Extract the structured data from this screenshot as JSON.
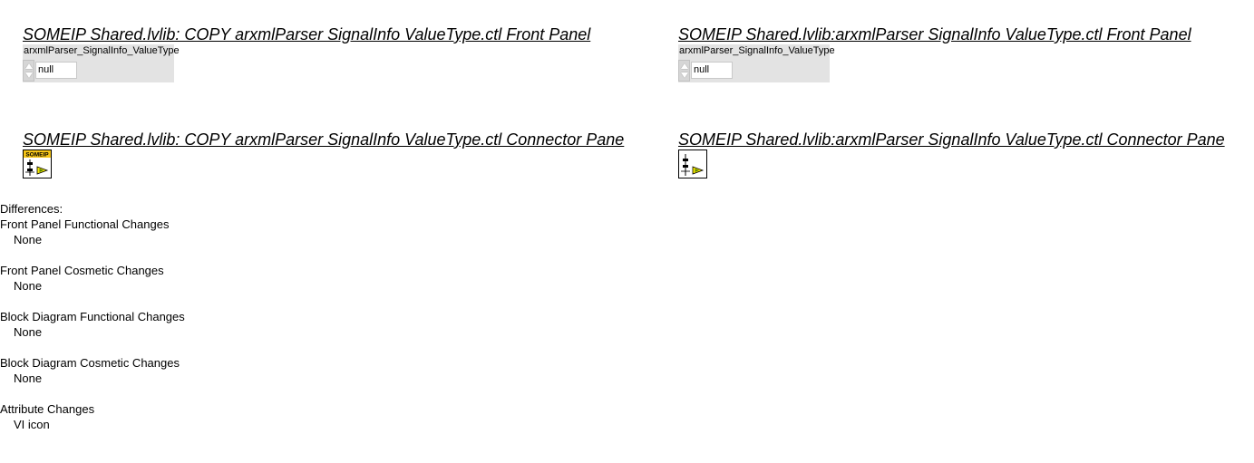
{
  "left": {
    "front_panel_title": "SOMEIP Shared.lvlib:  COPY  arxmlParser  SignalInfo  ValueType.ctl Front Panel",
    "control_label": "arxmlParser_SignalInfo_ValueType",
    "control_value": "null",
    "connector_pane_title": "SOMEIP Shared.lvlib:  COPY  arxmlParser  SignalInfo  ValueType.ctl Connector Pane",
    "icon_banner": "SOMEIP"
  },
  "right": {
    "front_panel_title": "SOMEIP Shared.lvlib:arxmlParser  SignalInfo  ValueType.ctl Front Panel",
    "control_label": "arxmlParser_SignalInfo_ValueType",
    "control_value": "null",
    "connector_pane_title": "SOMEIP Shared.lvlib:arxmlParser  SignalInfo  ValueType.ctl Connector Pane"
  },
  "differences": {
    "heading": "Differences:",
    "sections": [
      {
        "title": "Front Panel Functional Changes",
        "value": "None"
      },
      {
        "title": "Front Panel Cosmetic Changes",
        "value": "None"
      },
      {
        "title": "Block Diagram Functional Changes",
        "value": "None"
      },
      {
        "title": "Block Diagram Cosmetic Changes",
        "value": "None"
      },
      {
        "title": "Attribute Changes",
        "value": "VI icon"
      }
    ]
  },
  "colors": {
    "panel_background": "#e3e3e3",
    "icon_banner": "#f5c518",
    "icon_arrow": "#f7e600"
  }
}
